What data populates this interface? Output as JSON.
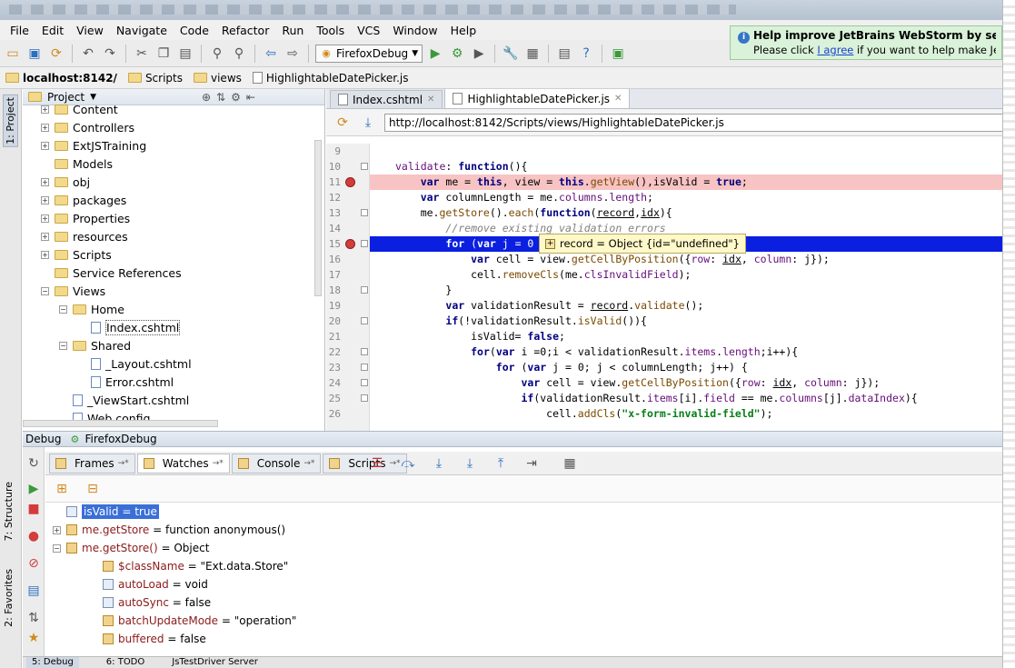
{
  "menu": [
    "File",
    "Edit",
    "View",
    "Navigate",
    "Code",
    "Refactor",
    "Run",
    "Tools",
    "VCS",
    "Window",
    "Help"
  ],
  "toolbar": {
    "run_config": "FirefoxDebug"
  },
  "notification": {
    "title": "Help improve JetBrains WebStorm by sending",
    "prefix": "Please click ",
    "link": "I agree",
    "suffix": " if you want to help make JetBrains W"
  },
  "breadcrumbs": [
    "localhost:8142/",
    "Scripts",
    "views",
    "HighlightableDatePicker.js"
  ],
  "side_tabs": {
    "project": "1: Project",
    "structure": "7: Structure",
    "favorites": "2: Favorites"
  },
  "project": {
    "header": "Project",
    "tree": [
      {
        "label": "Content",
        "indent": 0,
        "type": "folder",
        "exp": "+"
      },
      {
        "label": "Controllers",
        "indent": 0,
        "type": "folder",
        "exp": "+"
      },
      {
        "label": "ExtJSTraining",
        "indent": 0,
        "type": "folder",
        "exp": "+"
      },
      {
        "label": "Models",
        "indent": 0,
        "type": "folder",
        "exp": ""
      },
      {
        "label": "obj",
        "indent": 0,
        "type": "folder",
        "exp": "+"
      },
      {
        "label": "packages",
        "indent": 0,
        "type": "folder",
        "exp": "+"
      },
      {
        "label": "Properties",
        "indent": 0,
        "type": "folder",
        "exp": "+"
      },
      {
        "label": "resources",
        "indent": 0,
        "type": "folder",
        "exp": "+"
      },
      {
        "label": "Scripts",
        "indent": 0,
        "type": "folder",
        "exp": "+"
      },
      {
        "label": "Service References",
        "indent": 0,
        "type": "folder",
        "exp": ""
      },
      {
        "label": "Views",
        "indent": 0,
        "type": "folder",
        "exp": "−"
      },
      {
        "label": "Home",
        "indent": 1,
        "type": "folder",
        "exp": "−"
      },
      {
        "label": "Index.cshtml",
        "indent": 2,
        "type": "file",
        "exp": ""
      },
      {
        "label": "Shared",
        "indent": 1,
        "type": "folder",
        "exp": "−"
      },
      {
        "label": "_Layout.cshtml",
        "indent": 2,
        "type": "file",
        "exp": ""
      },
      {
        "label": "Error.cshtml",
        "indent": 2,
        "type": "file",
        "exp": ""
      },
      {
        "label": "_ViewStart.cshtml",
        "indent": 1,
        "type": "file",
        "exp": ""
      },
      {
        "label": "Web.config",
        "indent": 1,
        "type": "file",
        "exp": ""
      }
    ]
  },
  "editor": {
    "tabs": [
      {
        "label": "Index.cshtml",
        "active": false
      },
      {
        "label": "HighlightableDatePicker.js",
        "active": true
      }
    ],
    "url": "http://localhost:8142/Scripts/views/HighlightableDatePicker.js",
    "lines": [
      {
        "n": "9",
        "html": "",
        "cls": ""
      },
      {
        "n": "10",
        "html": "<span class='prop'>validate</span>: <span class='kw'>function</span>(){",
        "cls": ""
      },
      {
        "n": "11",
        "html": "    <span class='kw'>var</span> me = <span class='kw'>this</span>, view = <span class='kw'>this</span>.<span class='fn'>getView</span>(),isValid = <span class='kw'>true</span>;",
        "cls": "bp"
      },
      {
        "n": "12",
        "html": "    <span class='kw'>var</span> columnLength = me.<span class='prop'>columns</span>.<span class='prop'>length</span>;",
        "cls": ""
      },
      {
        "n": "13",
        "html": "    me.<span class='fn'>getStore</span>().<span class='fn'>each</span>(<span class='kw'>function</span>(<u>record</u>,<u>idx</u>){",
        "cls": ""
      },
      {
        "n": "14",
        "html": "        <span class='cm'>//remove existing validation errors</span>",
        "cls": ""
      },
      {
        "n": "15",
        "html": "        <span class='kw'>for</span> (<span class='kw'>var</span> j = 0",
        "cls": "exec"
      },
      {
        "n": "16",
        "html": "            <span class='kw'>var</span> cell = view.<span class='fn'>getCellByPosition</span>({<span class='prop'>row</span>: <u>idx</u>, <span class='prop'>column</span>: j});",
        "cls": ""
      },
      {
        "n": "17",
        "html": "            cell.<span class='fn'>removeCls</span>(me.<span class='prop'>clsInvalidField</span>);",
        "cls": ""
      },
      {
        "n": "18",
        "html": "        }",
        "cls": ""
      },
      {
        "n": "19",
        "html": "        <span class='kw'>var</span> validationResult = <u>record</u>.<span class='fn'>validate</span>();",
        "cls": ""
      },
      {
        "n": "20",
        "html": "        <span class='kw'>if</span>(!validationResult.<span class='fn'>isValid</span>()){",
        "cls": ""
      },
      {
        "n": "21",
        "html": "            isValid= <span class='kw'>false</span>;",
        "cls": ""
      },
      {
        "n": "22",
        "html": "            <span class='kw'>for</span>(<span class='kw'>var</span> i =0;i &lt; validationResult.<span class='prop'>items</span>.<span class='prop'>length</span>;i++){",
        "cls": ""
      },
      {
        "n": "23",
        "html": "                <span class='kw'>for</span> (<span class='kw'>var</span> j = 0; j &lt; columnLength; j++) {",
        "cls": ""
      },
      {
        "n": "24",
        "html": "                    <span class='kw'>var</span> cell = view.<span class='fn'>getCellByPosition</span>({<span class='prop'>row</span>: <u>idx</u>, <span class='prop'>column</span>: j});",
        "cls": ""
      },
      {
        "n": "25",
        "html": "                    <span class='kw'>if</span>(validationResult.<span class='prop'>items</span>[i].<span class='prop'>field</span> == me.<span class='prop'>columns</span>[j].<span class='prop'>dataIndex</span>){",
        "cls": ""
      },
      {
        "n": "26",
        "html": "                        cell.<span class='fn'>addCls</span>(<span class='str'>\"x-form-invalid-field\"</span>);",
        "cls": ""
      }
    ],
    "tooltip": "record = Object {id=\"undefined\"}"
  },
  "debug": {
    "label": "Debug",
    "config": "FirefoxDebug",
    "tabs": [
      {
        "label": "Frames",
        "active": false
      },
      {
        "label": "Watches",
        "active": true
      },
      {
        "label": "Console",
        "active": false
      },
      {
        "label": "Scripts",
        "active": false
      }
    ],
    "watches": [
      {
        "name": "isValid",
        "value": " = true",
        "indent": 0,
        "exp": "",
        "selected": true,
        "obj": false
      },
      {
        "name": "me.getStore",
        "value": " = function anonymous()",
        "indent": 0,
        "exp": "+",
        "selected": false,
        "obj": true
      },
      {
        "name": "me.getStore()",
        "value": " = Object",
        "indent": 0,
        "exp": "−",
        "selected": false,
        "obj": true
      },
      {
        "name": "$className",
        "value": " = \"Ext.data.Store\"",
        "indent": 1,
        "exp": "",
        "selected": false,
        "obj": true
      },
      {
        "name": "autoLoad",
        "value": " = void",
        "indent": 1,
        "exp": "",
        "selected": false,
        "obj": false
      },
      {
        "name": "autoSync",
        "value": " = false",
        "indent": 1,
        "exp": "",
        "selected": false,
        "obj": false
      },
      {
        "name": "batchUpdateMode",
        "value": " = \"operation\"",
        "indent": 1,
        "exp": "",
        "selected": false,
        "obj": true
      },
      {
        "name": "buffered",
        "value": " = false",
        "indent": 1,
        "exp": "",
        "selected": false,
        "obj": true
      }
    ]
  },
  "bottom_tabs": [
    "5: Debug",
    "6: TODO",
    "JsTestDriver Server"
  ]
}
